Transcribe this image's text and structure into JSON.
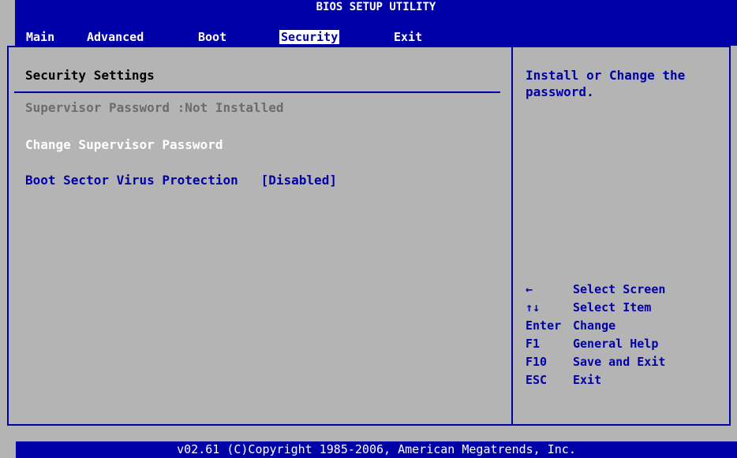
{
  "title": "BIOS SETUP UTILITY",
  "menu": {
    "items": [
      {
        "label": "Main"
      },
      {
        "label": "Advanced"
      },
      {
        "label": "Boot"
      },
      {
        "label": "Security"
      },
      {
        "label": "Exit"
      }
    ],
    "active": "Security"
  },
  "main": {
    "section_title": "Security Settings",
    "supervisor_password_label": "Supervisor Password",
    "supervisor_password_status": ":Not Installed",
    "change_supervisor_password": "Change Supervisor Password",
    "boot_sector_label": "Boot Sector Virus Protection",
    "boot_sector_value": "[Disabled]"
  },
  "help": {
    "text": "Install or Change the password."
  },
  "keys": [
    {
      "key": "←",
      "icon": "left-arrow-icon",
      "action": "Select Screen"
    },
    {
      "key": "↑↓",
      "icon": "up-down-arrow-icon",
      "action": "Select Item"
    },
    {
      "key": "Enter",
      "action": "Change"
    },
    {
      "key": "F1",
      "action": "General Help"
    },
    {
      "key": "F10",
      "action": "Save and Exit"
    },
    {
      "key": "ESC",
      "action": "Exit"
    }
  ],
  "footer": "v02.61 (C)Copyright 1985-2006, American Megatrends, Inc.",
  "colors": {
    "bios_blue": "#0000a8",
    "background_grey": "#b4b4b4",
    "disabled_text": "#6c6c6c",
    "white": "#ffffff"
  }
}
